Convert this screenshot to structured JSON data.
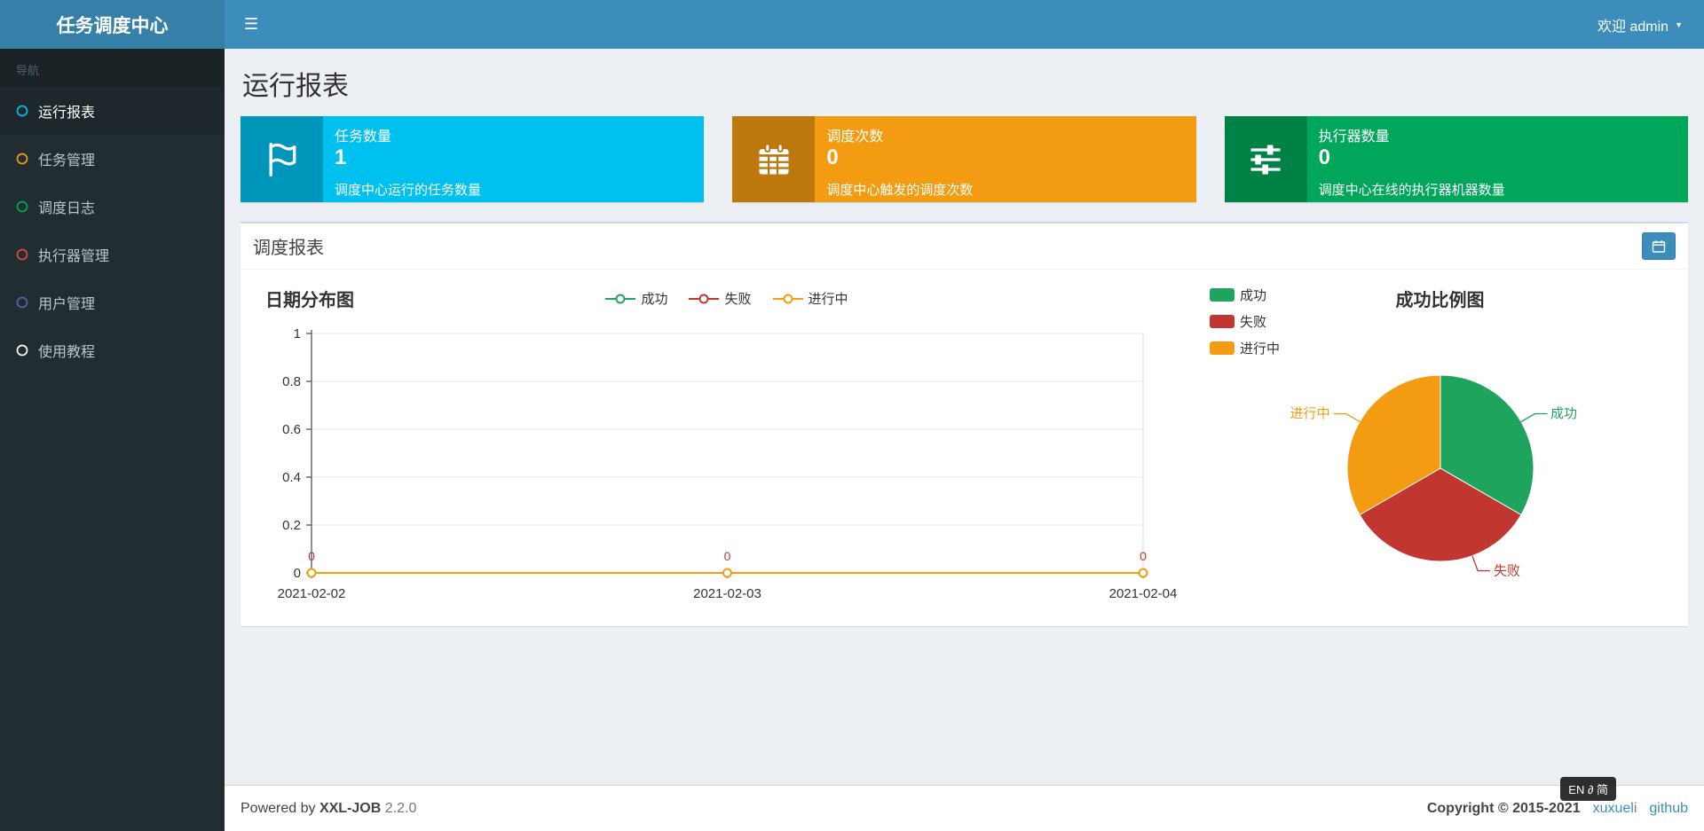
{
  "icons": {
    "hamburger": "☰",
    "caret": "▼"
  },
  "header": {
    "app_title": "任务调度中心",
    "welcome": "欢迎 admin"
  },
  "sidebar": {
    "nav_label": "导航",
    "items": [
      {
        "label": "运行报表",
        "color": "#00c0ef",
        "active": true
      },
      {
        "label": "任务管理",
        "color": "#f39c12",
        "active": false
      },
      {
        "label": "调度日志",
        "color": "#00a65a",
        "active": false
      },
      {
        "label": "执行器管理",
        "color": "#dd4b39",
        "active": false
      },
      {
        "label": "用户管理",
        "color": "#605ca8",
        "active": false
      },
      {
        "label": "使用教程",
        "color": "#ffffff",
        "active": false
      }
    ]
  },
  "page": {
    "title": "运行报表"
  },
  "info_boxes": [
    {
      "icon": "flag",
      "title": "任务数量",
      "value": "1",
      "desc": "调度中心运行的任务数量",
      "color": "#00c0ef"
    },
    {
      "icon": "calendar",
      "title": "调度次数",
      "value": "0",
      "desc": "调度中心触发的调度次数",
      "color": "#f39c12"
    },
    {
      "icon": "sliders",
      "title": "执行器数量",
      "value": "0",
      "desc": "调度中心在线的执行器机器数量",
      "color": "#00a65a"
    }
  ],
  "panel": {
    "title": "调度报表"
  },
  "chart_data": [
    {
      "type": "line",
      "title": "日期分布图",
      "x": [
        "2021-02-02",
        "2021-02-03",
        "2021-02-04"
      ],
      "yticks": [
        "1",
        "0.8",
        "0.6",
        "0.4",
        "0.2",
        "0"
      ],
      "ylim": [
        0,
        1
      ],
      "grid": true,
      "legend_position": "top",
      "series": [
        {
          "name": "成功",
          "color": "#1fa45d",
          "values": [
            0,
            0,
            0
          ]
        },
        {
          "name": "失败",
          "color": "#c23632",
          "values": [
            0,
            0,
            0
          ]
        },
        {
          "name": "进行中",
          "color": "#f39c12",
          "values": [
            0,
            0,
            0
          ]
        }
      ],
      "point_labels": [
        "0",
        "0",
        "0"
      ]
    },
    {
      "type": "pie",
      "title": "成功比例图",
      "legend_position": "left",
      "slices": [
        {
          "name": "成功",
          "value": 33.33,
          "color": "#1fa45d"
        },
        {
          "name": "失败",
          "value": 33.33,
          "color": "#c23632"
        },
        {
          "name": "进行中",
          "value": 33.33,
          "color": "#f39c12"
        }
      ]
    }
  ],
  "footer": {
    "powered_prefix": "Powered by",
    "brand": "XXL-JOB",
    "version": "2.2.0",
    "copyright": "Copyright © 2015-2021",
    "links": [
      {
        "label": "xuxueli"
      },
      {
        "label": "github"
      }
    ]
  },
  "ime_badge": {
    "text": "EN ∂ 简"
  }
}
